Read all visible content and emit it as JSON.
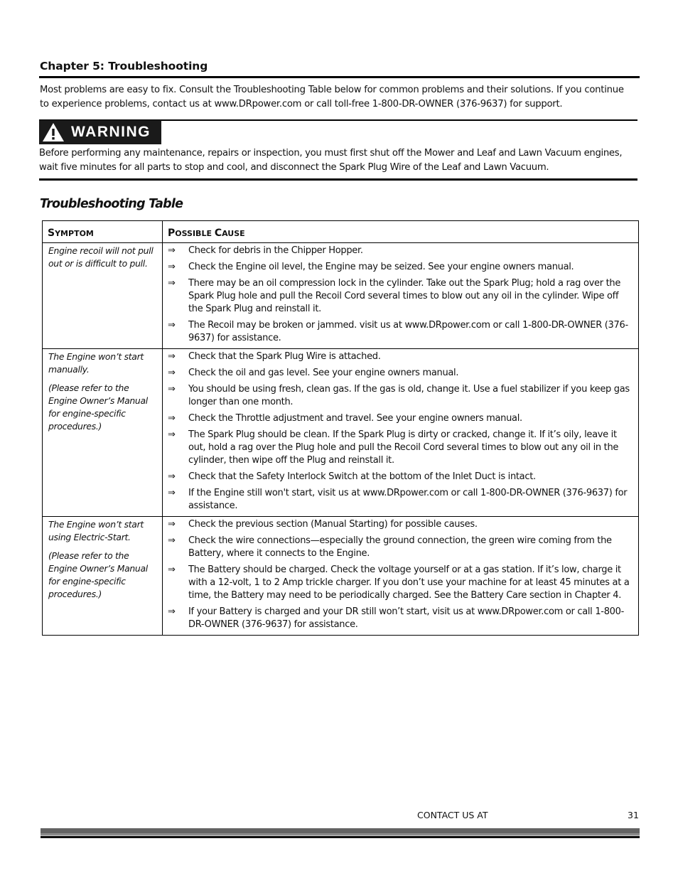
{
  "chapter": {
    "title": "Chapter 5: Troubleshooting",
    "intro": "Most problems are easy to fix. Consult the Troubleshooting Table below for common problems and their solutions. If you continue to experience problems, contact us at www.DRpower.com or call toll-free 1-800-DR-OWNER (376-9637) for support."
  },
  "warning": {
    "icon": "warning-triangle-icon",
    "label": "WARNING",
    "text": "Before performing any maintenance, repairs or inspection, you must first shut off the Mower and Leaf and Lawn Vacuum engines, wait five minutes for all parts to stop and cool, and disconnect the Spark Plug Wire of the Leaf and Lawn Vacuum."
  },
  "table": {
    "title": "Troubleshooting Table",
    "headers": {
      "symptom": {
        "first": "S",
        "rest": "YMPTOM"
      },
      "cause": {
        "first1": "P",
        "rest1": "OSSIBLE ",
        "first2": "C",
        "rest2": "AUSE"
      }
    },
    "bullet_glyph": "⇒",
    "rows": [
      {
        "symptom": [
          "Engine recoil will not pull out or is difficult to pull."
        ],
        "causes": [
          "Check for debris in the Chipper Hopper.",
          "Check the Engine oil level, the Engine may be seized.  See your engine owners manual.",
          "There may be an oil compression lock in the cylinder.  Take out the Spark Plug; hold a rag over the Spark Plug hole and pull the Recoil Cord several times to blow out any oil in the cylinder. Wipe off the Spark Plug and reinstall it.",
          "The Recoil may be broken or jammed.  visit us at www.DRpower.com or call 1-800-DR-OWNER (376-9637) for assistance."
        ]
      },
      {
        "symptom": [
          "The Engine won’t start manually.",
          "(Please refer to the Engine Owner’s Manual for engine-specific procedures.)"
        ],
        "causes": [
          "Check that the Spark Plug Wire is attached.",
          "Check the oil and gas level.  See your engine owners manual.",
          "You should be using fresh, clean gas.  If the gas is old, change it.  Use a fuel stabilizer if you keep gas longer than one month.",
          "Check the Throttle adjustment and travel.  See your engine owners manual.",
          "The Spark Plug should be clean.  If the Spark Plug is dirty or cracked, change it.  If it’s oily, leave it out, hold a rag over the Plug hole and pull the Recoil Cord several times to blow out any oil in the cylinder, then wipe off the Plug and reinstall it.",
          "Check that the Safety Interlock Switch at the bottom of the Inlet Duct is intact.",
          "If the Engine still won't start, visit us at www.DRpower.com or call 1-800-DR-OWNER (376-9637) for assistance."
        ]
      },
      {
        "symptom": [
          "The Engine won’t start using Electric-Start.",
          "(Please refer to the Engine Owner’s Manual for engine-specific procedures.)"
        ],
        "causes": [
          "Check the previous section (Manual Starting) for possible causes.",
          "Check the wire connections—especially the ground connection, the green wire coming from the Battery, where it connects to the Engine.",
          "The Battery should be charged.  Check the voltage yourself or at a gas station.  If it’s low, charge it with a 12-volt, 1 to 2 Amp trickle charger.  If you don’t use your machine for at least 45 minutes at a time, the Battery may need to be periodically charged. See the Battery Care section in Chapter 4.",
          "If your Battery is charged and your DR still won’t start, visit us at www.DRpower.com or call 1-800-DR-OWNER (376-9637) for assistance."
        ]
      }
    ]
  },
  "footer": {
    "contact": "CONTACT US AT",
    "page_number": "31"
  }
}
